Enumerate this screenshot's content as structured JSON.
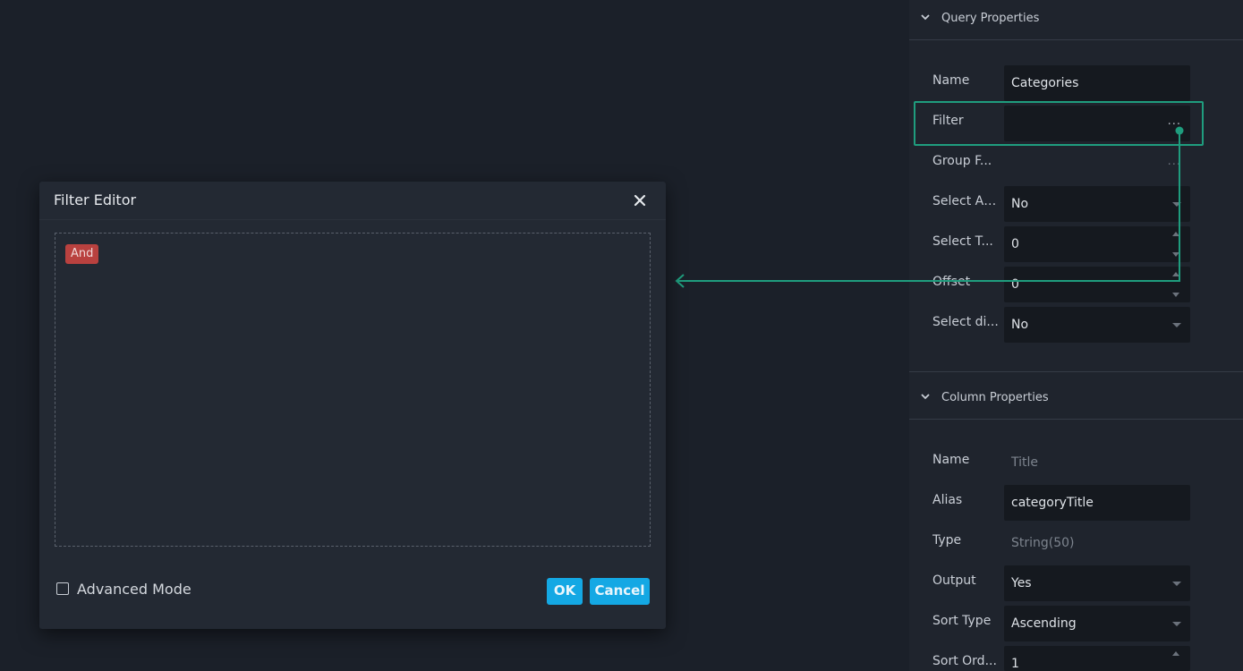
{
  "query_properties": {
    "title": "Query Properties",
    "rows": {
      "name": {
        "label": "Name",
        "value": "Categories"
      },
      "filter": {
        "label": "Filter",
        "value": "",
        "ellipsis": "..."
      },
      "group_filter": {
        "label": "Group F...",
        "ellipsis": "..."
      },
      "select_all": {
        "label": "Select Al...",
        "value": "No"
      },
      "select_top": {
        "label": "Select T...",
        "value": "0"
      },
      "offset": {
        "label": "Offset",
        "value": "0"
      },
      "select_distinct": {
        "label": "Select di...",
        "value": "No"
      }
    }
  },
  "column_properties": {
    "title": "Column Properties",
    "rows": {
      "name": {
        "label": "Name",
        "value": "Title"
      },
      "alias": {
        "label": "Alias",
        "value": "categoryTitle"
      },
      "type": {
        "label": "Type",
        "value": "String(50)"
      },
      "output": {
        "label": "Output",
        "value": "Yes"
      },
      "sort_type": {
        "label": "Sort Type",
        "value": "Ascending"
      },
      "sort_order": {
        "label": "Sort Ord...",
        "value": "1"
      }
    }
  },
  "filter_editor": {
    "title": "Filter Editor",
    "group_operator": "And",
    "advanced_mode_label": "Advanced Mode",
    "advanced_mode_checked": false,
    "ok_label": "OK",
    "cancel_label": "Cancel"
  },
  "colors": {
    "highlight": "#1f9d7e",
    "button": "#14a8e4",
    "and_chip": "#b9413f"
  },
  "icons": {
    "section_toggle": "chevron-down-icon",
    "close": "close-icon",
    "dropdown": "caret-down-icon"
  }
}
